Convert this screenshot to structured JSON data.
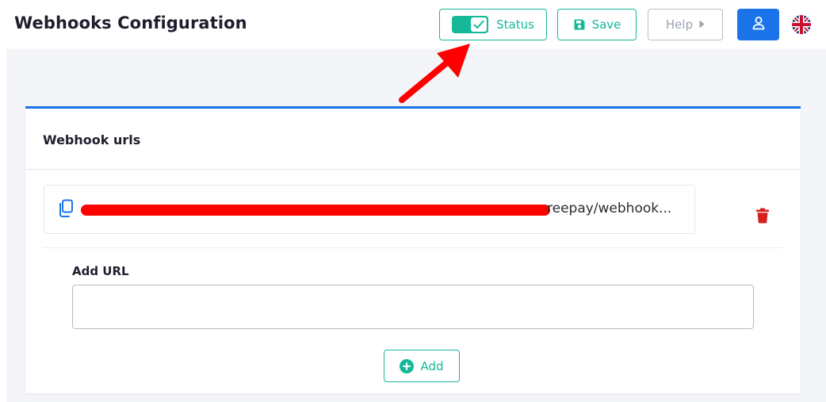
{
  "header": {
    "title": "Webhooks Configuration",
    "status_label": "Status",
    "save_label": "Save",
    "help_label": "Help"
  },
  "card": {
    "title": "Webhook urls",
    "url_visible_text": "reepay/webhook...",
    "add_url_label": "Add URL",
    "add_url_value": "",
    "add_button_label": "Add"
  },
  "colors": {
    "accent": "#16b89a",
    "primary": "#1a73e8",
    "danger": "#d41f1f",
    "annotation": "#ff0000"
  },
  "icons": {
    "status": "toggle-check-icon",
    "save": "floppy-disk-icon",
    "help": "caret-right-icon",
    "user": "user-icon",
    "language": "uk-flag-icon",
    "copy": "copy-icon",
    "delete": "trash-icon",
    "add": "plus-circle-icon"
  }
}
